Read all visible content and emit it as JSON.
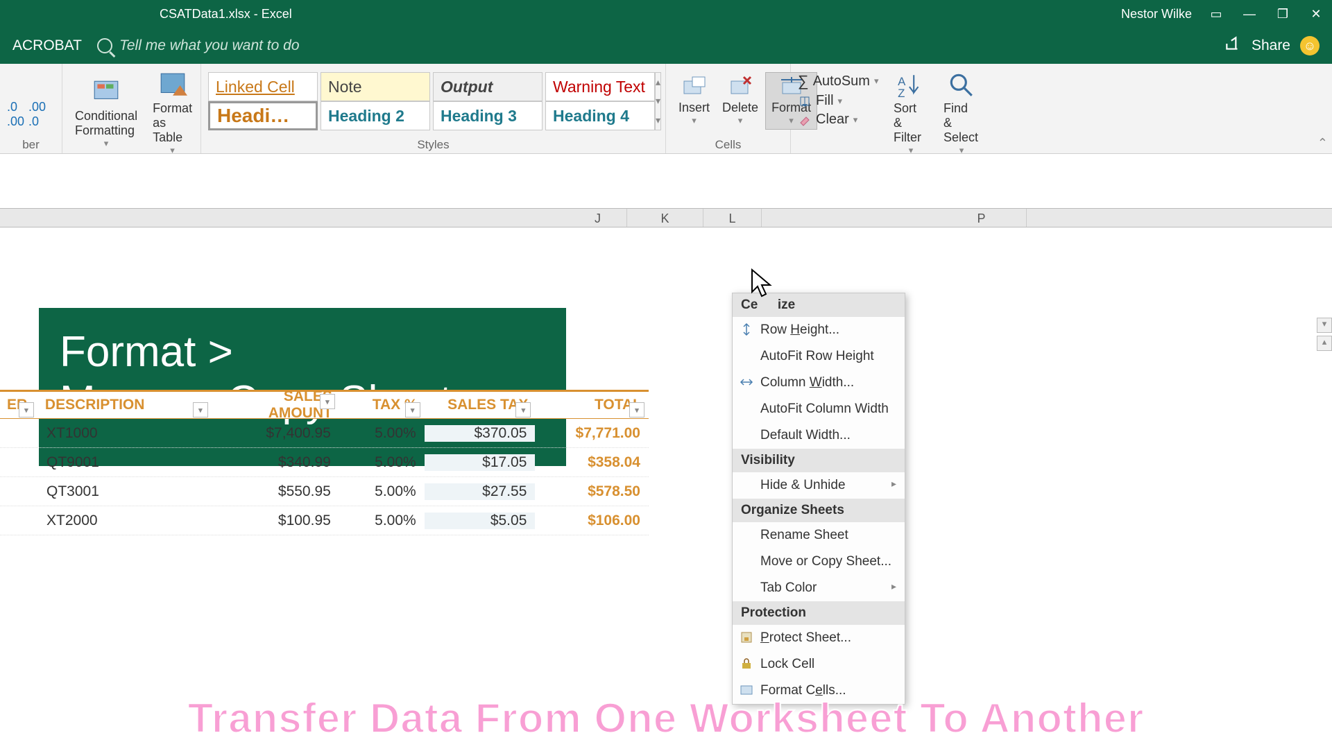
{
  "titlebar": {
    "filename": "CSATData1.xlsx  -  Excel",
    "user": "Nestor Wilke"
  },
  "secbar": {
    "tab": "ACROBAT",
    "tellme": "Tell me what you want to do",
    "share": "Share"
  },
  "ribbon": {
    "number_group_label": "ber",
    "conditional": "Conditional\nFormatting",
    "formatas": "Format as\nTable",
    "styles_label": "Styles",
    "style_linked": "Linked Cell",
    "style_note": "Note",
    "style_output": "Output",
    "style_warning": "Warning Text",
    "style_h1": "Headi…",
    "style_h2": "Heading 2",
    "style_h3": "Heading 3",
    "style_h4": "Heading 4",
    "cells_label": "Cells",
    "insert": "Insert",
    "delete": "Delete",
    "format": "Format",
    "autosum": "AutoSum",
    "fill": "Fill",
    "clear": "Clear",
    "sortfilter": "Sort &\nFilter",
    "findselect": "Find &\nSelect"
  },
  "cols": {
    "j": "J",
    "k": "K",
    "l": "L",
    "p": "P"
  },
  "overlay": {
    "line1": "Format  >",
    "line2": "Move or Copy Sheet"
  },
  "table": {
    "h_er": "ER",
    "h_desc": "DESCRIPTION",
    "h_sales": "SALES AMOUNT",
    "h_taxp": "TAX %",
    "h_tax": "SALES TAX",
    "h_total": "TOTAL",
    "rows": [
      {
        "desc": "XT1000",
        "sales": "$7,400.95",
        "taxp": "5.00%",
        "tax": "$370.05",
        "total": "$7,771.00"
      },
      {
        "desc": "QT9001",
        "sales": "$340.99",
        "taxp": "5.00%",
        "tax": "$17.05",
        "total": "$358.04"
      },
      {
        "desc": "QT3001",
        "sales": "$550.95",
        "taxp": "5.00%",
        "tax": "$27.55",
        "total": "$578.50"
      },
      {
        "desc": "XT2000",
        "sales": "$100.95",
        "taxp": "5.00%",
        "tax": "$5.05",
        "total": "$106.00"
      }
    ]
  },
  "format_menu": {
    "cellsize": "Cell Size",
    "rowheight": "Row Height...",
    "autofitrow": "AutoFit Row Height",
    "colwidth": "Column Width...",
    "autofitcol": "AutoFit Column Width",
    "defwidth": "Default Width...",
    "visibility": "Visibility",
    "hideunhide": "Hide & Unhide",
    "organize": "Organize Sheets",
    "rename": "Rename Sheet",
    "movecopy": "Move or Copy Sheet...",
    "tabcolor": "Tab Color",
    "protection": "Protection",
    "protectsheet": "Protect Sheet...",
    "lockcell": "Lock Cell",
    "formatcells": "Format Cells..."
  },
  "pink": "Transfer Data From One Worksheet To Another"
}
